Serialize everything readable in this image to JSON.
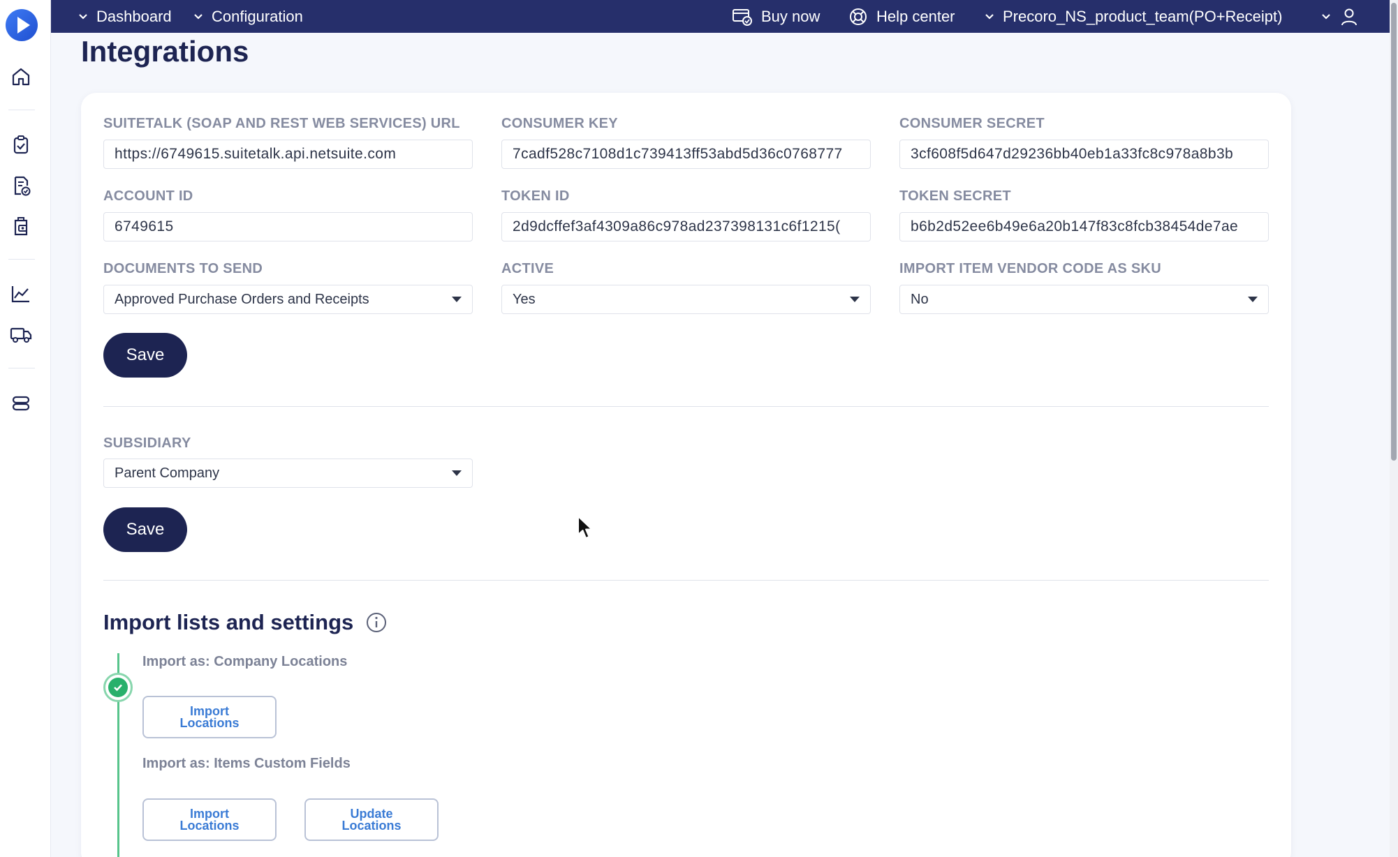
{
  "topbar": {
    "dashboard_label": "Dashboard",
    "configuration_label": "Configuration",
    "buy_now_label": "Buy now",
    "help_center_label": "Help center",
    "company_label": "Precoro_NS_product_team(PO+Receipt)"
  },
  "page": {
    "title": "Integrations"
  },
  "form": {
    "suitetalk_url": {
      "label": "SUITETALK (SOAP AND REST WEB SERVICES) URL",
      "value": "https://6749615.suitetalk.api.netsuite.com"
    },
    "consumer_key": {
      "label": "CONSUMER KEY",
      "value": "7cadf528c7108d1c739413ff53abd5d36c0768777"
    },
    "consumer_secret": {
      "label": "CONSUMER SECRET",
      "value": "3cf608f5d647d29236bb40eb1a33fc8c978a8b3b"
    },
    "account_id": {
      "label": "ACCOUNT ID",
      "value": "6749615"
    },
    "token_id": {
      "label": "TOKEN ID",
      "value": "2d9dcffef3af4309a86c978ad237398131c6f1215("
    },
    "token_secret": {
      "label": "TOKEN SECRET",
      "value": "b6b2d52ee6b49e6a20b147f83c8fcb38454de7ae"
    },
    "documents_to_send": {
      "label": "DOCUMENTS TO SEND",
      "value": "Approved Purchase Orders and Receipts"
    },
    "active": {
      "label": "ACTIVE",
      "value": "Yes"
    },
    "import_vendor_code": {
      "label": "IMPORT ITEM VENDOR CODE AS SKU",
      "value": "No"
    },
    "save_label": "Save"
  },
  "subsidiary": {
    "label": "SUBSIDIARY",
    "value": "Parent Company",
    "save_label": "Save"
  },
  "import_section": {
    "title": "Import lists and settings",
    "company_locations_label": "Import as: Company Locations",
    "import_locations_button": "Import\nLocations",
    "items_custom_fields_label": "Import as: Items Custom Fields",
    "import_locations_button_2": "Import\nLocations",
    "update_locations_button": "Update\nLocations"
  },
  "colors": {
    "topbar_bg": "#262f6b",
    "primary_button": "#1d2452",
    "timeline_green": "#28b06b",
    "outline_button_text": "#3a7bd5"
  },
  "icons": [
    "logo-icon",
    "home-icon",
    "clipboard-check-icon",
    "document-check-icon",
    "receipt-icon",
    "chart-line-icon",
    "truck-icon",
    "database-icon",
    "cart-card-icon",
    "lifebuoy-icon",
    "user-icon",
    "chevron-down-icon",
    "info-icon",
    "check-icon"
  ]
}
